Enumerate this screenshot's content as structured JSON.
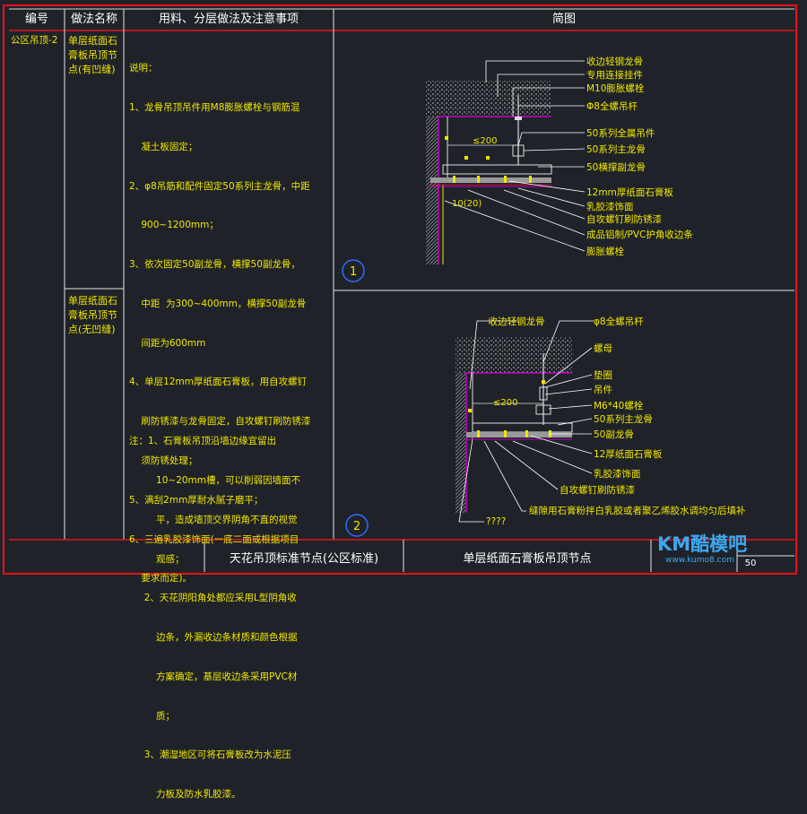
{
  "header": {
    "col_no": "编号",
    "col_method": "做法名称",
    "col_material": "用料、分层做法及注意事项",
    "col_diagram": "简图"
  },
  "row1": {
    "code": "公区吊顶-2",
    "method_lines": [
      "单层纸面石",
      "膏板吊顶节",
      "点(有凹缝)"
    ],
    "notes": [
      "说明：",
      "1、龙骨吊顶吊件用M8膨胀螺栓与钢筋混",
      "    凝土板固定；",
      "2、φ8吊筋和配件固定50系列主龙骨，中距",
      "    900~1200mm；",
      "3、依次固定50副龙骨，横撑50副龙骨，",
      "    中距  为300~400mm，横撑50副龙骨",
      "    间距为600mm",
      "4、单层12mm厚纸面石膏板，用自攻螺钉",
      "    刷防锈漆与龙骨固定，自攻螺钉刷防锈漆",
      "    须防锈处理；",
      "5、满刮2mm厚耐水腻子磨平；",
      "6、三遍乳胶漆饰面(一底二面或根据项目",
      "    要求而定)。"
    ]
  },
  "row2": {
    "method_lines": [
      "单层纸面石",
      "膏板吊顶节",
      "点(无凹缝)"
    ],
    "notes": [
      "注：1、石膏板吊顶沿墙边缘宜留出",
      "         10~20mm槽，可以削弱因墙面不",
      "         平，造成墙顶交界阴角不直的视觉",
      "         观感；",
      "     2、天花阴阳角处都应采用L型阴角收",
      "         边条，外漏收边条材质和颜色根据",
      "         方案确定，基层收边条采用PVC材",
      "         质；",
      "     3、潮湿地区可将石膏板改为水泥压",
      "         力板及防水乳胶漆。"
    ]
  },
  "diagram1": {
    "number": "1",
    "dim_200": "≤200",
    "dim_gap": "10(20)",
    "labels": [
      "收边轻钢龙骨",
      "专用连接挂件",
      "M10膨胀螺栓",
      "Φ8全螺吊杆",
      "50系列全属吊件",
      "50系列主龙骨",
      "50横撑副龙骨",
      "12mm厚纸面石膏板",
      "乳胶漆饰面",
      "自攻螺钉刷防锈漆",
      "成品铝制/PVC护角收边条",
      "膨胀螺栓"
    ]
  },
  "diagram2": {
    "number": "2",
    "dim_200": "≤200",
    "label_top_left": "收边轻钢龙骨",
    "label_top_right": "φ8全螺吊杆",
    "labels": [
      "螺母",
      "垫圈",
      "吊件",
      "M6*40螺栓",
      "50系列主龙骨",
      "50副龙骨",
      "12厚纸面石膏板",
      "乳胶漆饰面",
      "自攻螺钉刷防锈漆",
      "缝隙用石膏粉拌白乳胶或者聚乙烯胶水调均匀后填补",
      "????"
    ]
  },
  "title_block": {
    "left": "天花吊顶标准节点(公区标准)",
    "right": "单层纸面石膏板吊顶节点",
    "page": "50"
  },
  "watermark": {
    "brand": "KM酷模吧",
    "url": "www.kumo8.com"
  },
  "colors": {
    "frame": "#e8101c",
    "grid": "#e6e6e6",
    "text": "#f2e600",
    "leader": "#ffffff",
    "hatch": "#d8d8d8",
    "magenta": "#c400c4",
    "circle": "#2f6bff",
    "background": "#1f2329"
  }
}
